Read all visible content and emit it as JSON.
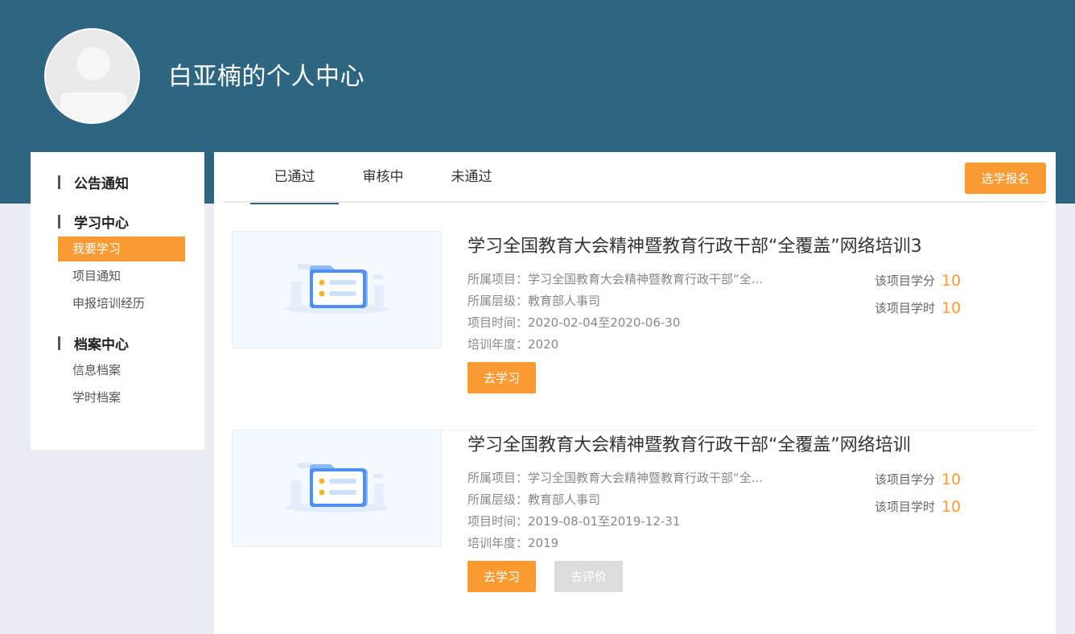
{
  "header": {
    "title": "白亚楠的个人中心"
  },
  "sidebar": {
    "sections": [
      {
        "label": "公告通知",
        "items": []
      },
      {
        "label": "学习中心",
        "items": [
          {
            "label": "我要学习",
            "active": true
          },
          {
            "label": "项目通知",
            "active": false
          },
          {
            "label": "申报培训经历",
            "active": false
          }
        ]
      },
      {
        "label": "档案中心",
        "items": [
          {
            "label": "信息档案",
            "active": false
          },
          {
            "label": "学时档案",
            "active": false
          }
        ]
      }
    ]
  },
  "tabs": [
    {
      "label": "已通过",
      "active": true
    },
    {
      "label": "审核中",
      "active": false
    },
    {
      "label": "未通过",
      "active": false
    }
  ],
  "enroll_button": "选学报名",
  "meta_labels": {
    "project": "所属项目：",
    "level": "所属层级：",
    "time": "项目时间：",
    "year": "培训年度："
  },
  "stat_labels": {
    "credits": "该项目学分",
    "hours": "该项目学时"
  },
  "courses": [
    {
      "title": "学习全国教育大会精神暨教育行政干部“全覆盖”网络培训3",
      "project": "学习全国教育大会精神暨教育行政干部“全...",
      "level": "教育部人事司",
      "time": "2020-02-04至2020-06-30",
      "year": "2020",
      "credits": "10",
      "hours": "10",
      "study_button": "去学习"
    },
    {
      "title": "学习全国教育大会精神暨教育行政干部“全覆盖”网络培训",
      "project": "学习全国教育大会精神暨教育行政干部“全...",
      "level": "教育部人事司",
      "time": "2019-08-01至2019-12-31",
      "year": "2019",
      "credits": "10",
      "hours": "10",
      "study_button": "去学习",
      "eval_button": "去评价"
    }
  ],
  "colors": {
    "banner": "#2e6580",
    "accent": "#f99b32",
    "disabled": "#dcdcdc"
  },
  "icons": {
    "avatar": "user-avatar-icon",
    "thumbnail": "folder-document-icon"
  }
}
